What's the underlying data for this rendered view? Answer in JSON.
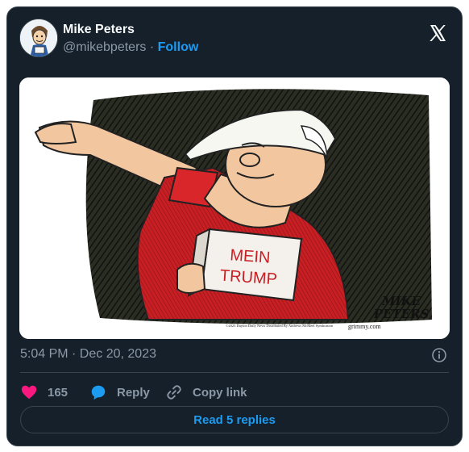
{
  "author": {
    "name": "Mike Peters",
    "handle": "@mikebpeters",
    "separator": "·",
    "follow_label": "Follow"
  },
  "media": {
    "book_line1": "MEIN",
    "book_line2": "TRUMP",
    "signature_line1": "MIKE",
    "signature_line2": "PETERS",
    "credit": "©2023 Dayton Daily News Distributed By Andrews McMeel Syndication",
    "site": "grimmy.com"
  },
  "timestamp": "5:04 PM · Dec 20, 2023",
  "actions": {
    "like_count": "165",
    "reply_label": "Reply",
    "copy_label": "Copy link"
  },
  "read_replies_label": "Read 5 replies",
  "colors": {
    "card_bg": "#15202b",
    "border": "#38444d",
    "accent": "#1d9bf0",
    "like": "#f91880",
    "muted": "#8b98a5",
    "shirt_red": "#d8262a"
  }
}
